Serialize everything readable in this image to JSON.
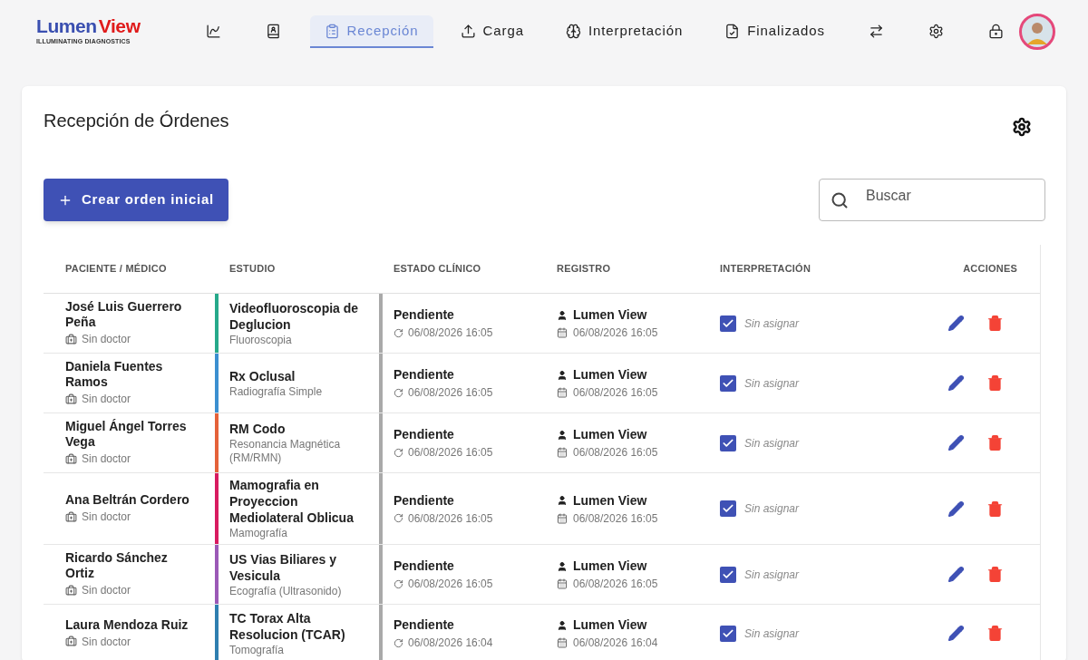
{
  "brand": {
    "name_part1": "Lumen",
    "name_part2": "View",
    "tagline": "ILLUMINATING DIAGNOSTICS"
  },
  "nav": [
    {
      "kind": "icon",
      "selected": false
    },
    {
      "kind": "icon",
      "selected": false
    },
    {
      "kind": "tab",
      "label": "Recepción",
      "selected": true
    },
    {
      "kind": "tab",
      "label": "Carga",
      "selected": false
    },
    {
      "kind": "tab",
      "label": "Interpretación",
      "selected": false
    },
    {
      "kind": "tab",
      "label": "Finalizados",
      "selected": false
    },
    {
      "kind": "icon",
      "selected": false
    },
    {
      "kind": "icon",
      "selected": false
    },
    {
      "kind": "icon",
      "selected": false
    }
  ],
  "page": {
    "title": "Recepción de Órdenes",
    "create_button": "Crear orden inicial",
    "search": {
      "placeholder": "Buscar"
    }
  },
  "table": {
    "columns": [
      "PACIENTE / MÉDICO",
      "ESTUDIO",
      "ESTADO CLÍNICO",
      "REGISTRO",
      "INTERPRETACIÓN",
      "ACCIONES"
    ],
    "rows": [
      {
        "patient": "José Luis Guerrero Peña",
        "doctor": "Sin doctor",
        "study": "Videofluoroscopia de Deglucion",
        "modality": "Fluoroscopia",
        "color": "#26a98a",
        "status": "Pendiente",
        "status_time": "06/08/2026 16:05",
        "registered_by": "Lumen View",
        "registered_at": "06/08/2026 16:05",
        "checked": true,
        "interpreter": "Sin asignar"
      },
      {
        "patient": "Daniela Fuentes Ramos",
        "doctor": "Sin doctor",
        "study": "Rx Oclusal",
        "modality": "Radiografía Simple",
        "color": "#3b8fd0",
        "status": "Pendiente",
        "status_time": "06/08/2026 16:05",
        "registered_by": "Lumen View",
        "registered_at": "06/08/2026 16:05",
        "checked": true,
        "interpreter": "Sin asignar"
      },
      {
        "patient": "Miguel Ángel Torres Vega",
        "doctor": "Sin doctor",
        "study": "RM Codo",
        "modality": "Resonancia Magnética (RM/RMN)",
        "color": "#e5623a",
        "status": "Pendiente",
        "status_time": "06/08/2026 16:05",
        "registered_by": "Lumen View",
        "registered_at": "06/08/2026 16:05",
        "checked": true,
        "interpreter": "Sin asignar"
      },
      {
        "patient": "Ana Beltrán Cordero",
        "doctor": "Sin doctor",
        "study": "Mamografia en Proyeccion Mediolateral Oblicua",
        "modality": "Mamografía",
        "color": "#d81b60",
        "status": "Pendiente",
        "status_time": "06/08/2026 16:05",
        "registered_by": "Lumen View",
        "registered_at": "06/08/2026 16:05",
        "checked": true,
        "interpreter": "Sin asignar"
      },
      {
        "patient": "Ricardo Sánchez Ortiz",
        "doctor": "Sin doctor",
        "study": "US Vias Biliares y Vesicula",
        "modality": "Ecografía (Ultrasonido)",
        "color": "#9b59b6",
        "status": "Pendiente",
        "status_time": "06/08/2026 16:05",
        "registered_by": "Lumen View",
        "registered_at": "06/08/2026 16:05",
        "checked": true,
        "interpreter": "Sin asignar"
      },
      {
        "patient": "Laura Mendoza Ruiz",
        "doctor": "Sin doctor",
        "study": "TC Torax Alta Resolucion (TCAR)",
        "modality": "Tomografía",
        "color": "#2f7fb0",
        "status": "Pendiente",
        "status_time": "06/08/2026 16:04",
        "registered_by": "Lumen View",
        "registered_at": "06/08/2026 16:04",
        "checked": true,
        "interpreter": "Sin asignar"
      }
    ]
  }
}
